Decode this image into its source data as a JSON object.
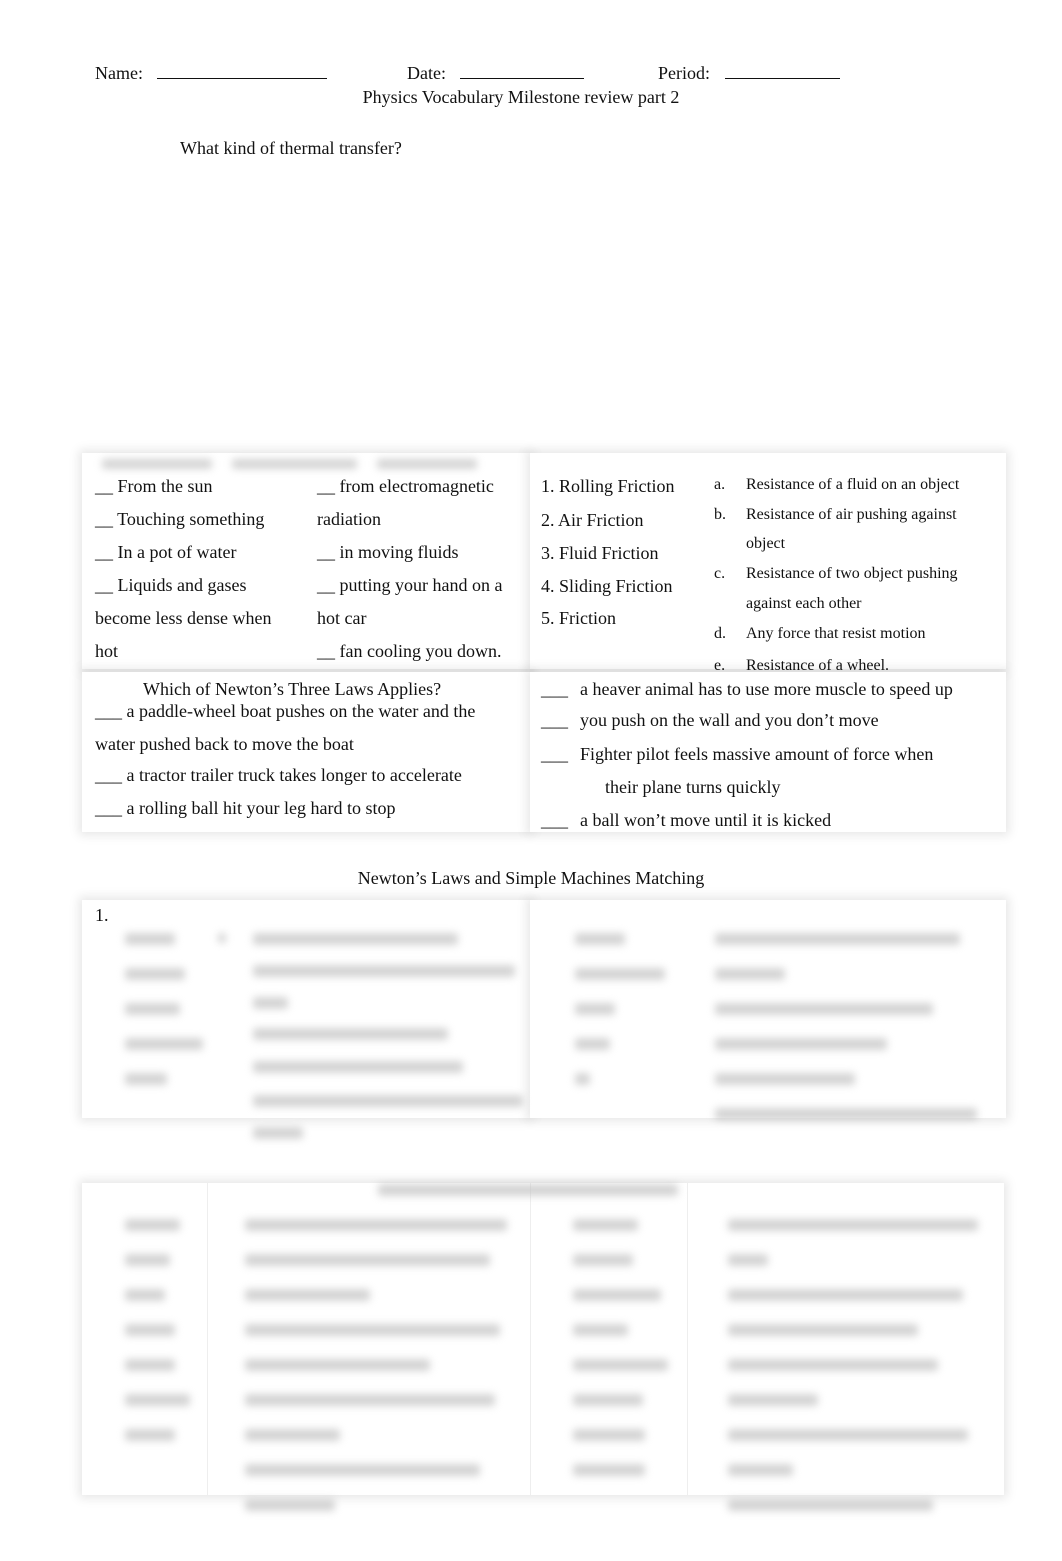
{
  "header": {
    "name_label": "Name:",
    "date_label": "Date:",
    "period_label": "Period:"
  },
  "title": "Physics Vocabulary Milestone review part 2",
  "thermal_question": "What kind of thermal transfer?",
  "thermal_items": {
    "left": [
      "__ From the sun",
      "__ Touching something",
      "__ In a pot of water",
      "__ Liquids and gases",
      "become less dense when",
      "hot"
    ],
    "right": [
      "__ from electromagnetic",
      "radiation",
      "__  in moving fluids",
      "__ putting your hand on a",
      "hot car",
      "__ fan cooling you down."
    ]
  },
  "friction_terms": [
    "1.  Rolling Friction",
    "2.  Air Friction",
    "3.  Fluid Friction",
    "4.  Sliding Friction",
    "5.  Friction"
  ],
  "friction_definitions": [
    {
      "letter": "a.",
      "lines": [
        "Resistance of a fluid on an object"
      ]
    },
    {
      "letter": "b.",
      "lines": [
        "Resistance of air pushing against",
        "object"
      ]
    },
    {
      "letter": "c.",
      "lines": [
        "Resistance of two object pushing",
        "against each other"
      ]
    },
    {
      "letter": "d.",
      "lines": [
        "Any force that resist motion"
      ]
    },
    {
      "letter": "e.",
      "lines": [
        "Resistance of a wheel."
      ]
    }
  ],
  "newton_question": "Which of Newton’s Three Laws Applies?",
  "newton_left": [
    "___ a paddle-wheel boat pushes on the water and the",
    "water pushed back to move the boat",
    "___ a tractor trailer truck takes longer to accelerate",
    "___ a rolling ball hit your leg hard to stop"
  ],
  "newton_right": [
    {
      "blank": "___",
      "text": "a heaver animal has to use more muscle to speed up"
    },
    {
      "blank": "___",
      "text": "you push on the wall and you don’t move"
    },
    {
      "blank": "___",
      "text": "Fighter pilot feels massive amount of force when"
    },
    {
      "blank": "",
      "text": "their plane turns quickly"
    },
    {
      "blank": "___",
      "text": "a ball won’t move until it is kicked"
    }
  ],
  "matching_title": "Newton’s Laws and Simple Machines Matching",
  "matching_number": "1."
}
